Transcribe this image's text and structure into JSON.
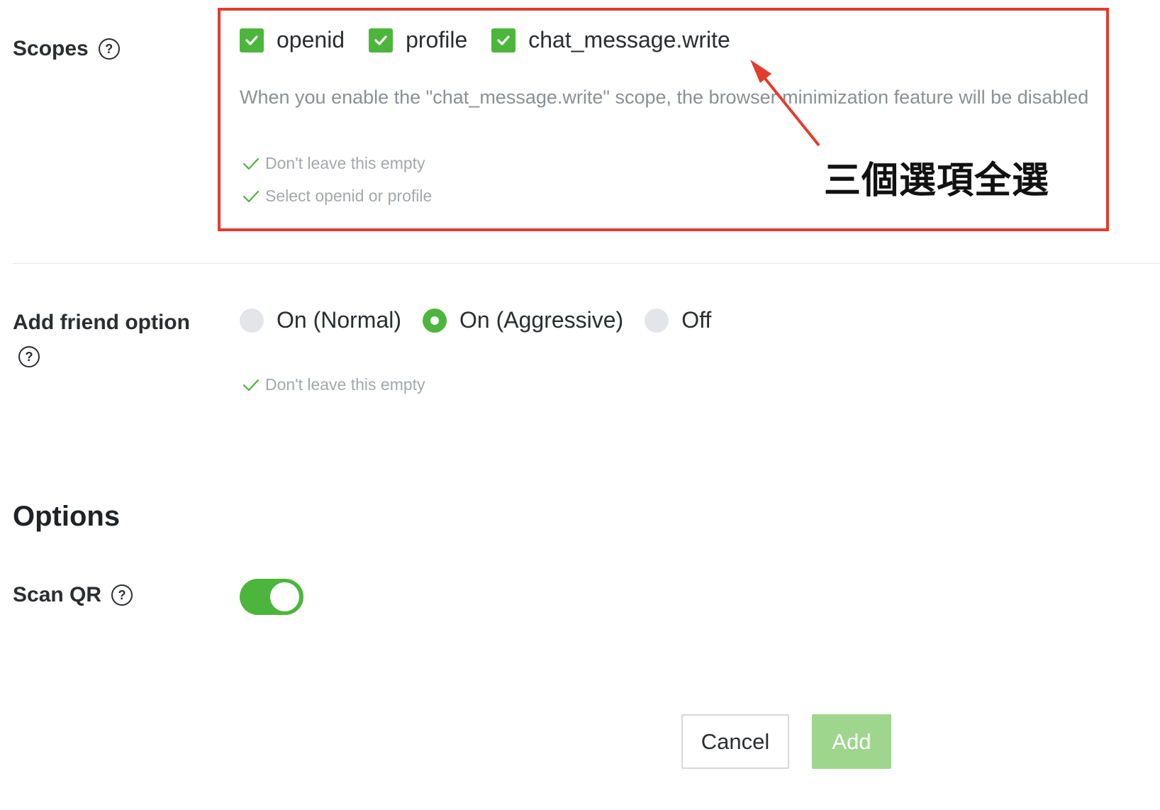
{
  "scopes": {
    "label": "Scopes",
    "help_icon": "question-circle-icon",
    "options": [
      {
        "label": "openid",
        "checked": true
      },
      {
        "label": "profile",
        "checked": true
      },
      {
        "label": "chat_message.write",
        "checked": true
      }
    ],
    "note": "When you enable the \"chat_message.write\" scope, the browser minimization feature will be disabled",
    "validations": [
      "Don't leave this empty",
      "Select openid or profile"
    ]
  },
  "annotation": {
    "text": "三個選項全選",
    "color": "#e53b2c"
  },
  "add_friend": {
    "label": "Add friend option",
    "help_icon": "question-circle-icon",
    "options": [
      {
        "label": "On (Normal)",
        "selected": false
      },
      {
        "label": "On (Aggressive)",
        "selected": true
      },
      {
        "label": "Off",
        "selected": false
      }
    ],
    "validation": "Don't leave this empty"
  },
  "options_section": {
    "title": "Options",
    "scan_qr": {
      "label": "Scan QR",
      "help_icon": "question-circle-icon",
      "enabled": true
    }
  },
  "buttons": {
    "cancel": "Cancel",
    "add": "Add"
  },
  "colors": {
    "accent_green": "#4cb63c",
    "add_button_disabled": "#9ed68d",
    "validation_check": "#4cb63c"
  }
}
